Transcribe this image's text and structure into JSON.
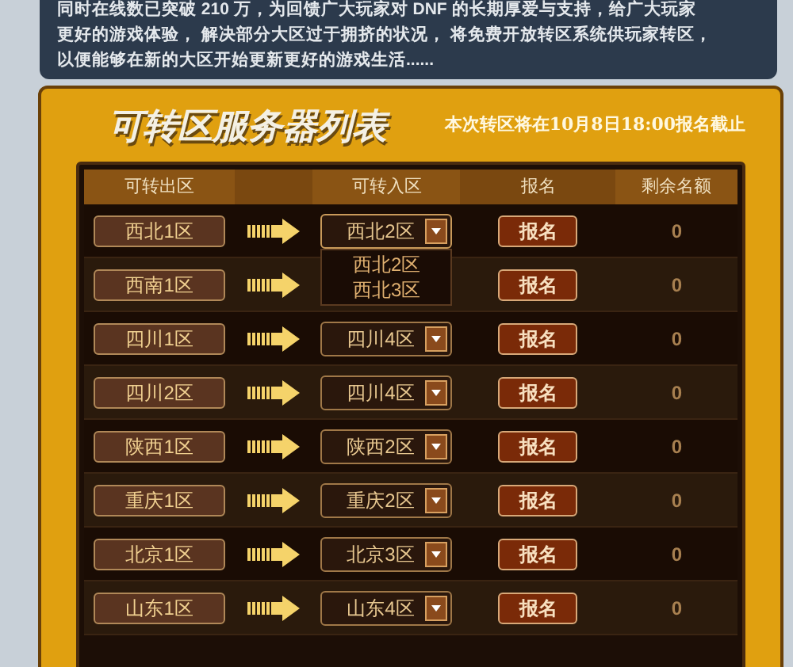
{
  "intro": {
    "lines": [
      "同时在线数已突破 210 万，为回馈广大玩家对 DNF 的长期厚爱与支持，给广大玩家",
      "更好的游戏体验， 解决部分大区过于拥挤的状况， 将免费开放转区系统供玩家转区，",
      "以便能够在新的大区开始更新更好的游戏生活......"
    ]
  },
  "panel": {
    "title": "可转区服务器列表",
    "notice": "本次转区将在10月8日18:00报名截止"
  },
  "table": {
    "columns": [
      "可转出区",
      "可转入区",
      "报名",
      "剩余名额"
    ],
    "rows": [
      {
        "source": "西北1区",
        "target": {
          "value": "西北2区",
          "expanded": true,
          "options": [
            "西北2区",
            "西北3区"
          ]
        },
        "action": "报名",
        "remaining": "0"
      },
      {
        "source": "西南1区",
        "action": "报名",
        "remaining": "0"
      },
      {
        "source": "四川1区",
        "target": {
          "value": "四川4区",
          "expanded": false
        },
        "action": "报名",
        "remaining": "0"
      },
      {
        "source": "四川2区",
        "target": {
          "value": "四川4区",
          "expanded": false
        },
        "action": "报名",
        "remaining": "0"
      },
      {
        "source": "陕西1区",
        "target": {
          "value": "陕西2区",
          "expanded": false
        },
        "action": "报名",
        "remaining": "0"
      },
      {
        "source": "重庆1区",
        "target": {
          "value": "重庆2区",
          "expanded": false
        },
        "action": "报名",
        "remaining": "0"
      },
      {
        "source": "北京1区",
        "target": {
          "value": "北京3区",
          "expanded": false
        },
        "action": "报名",
        "remaining": "0"
      },
      {
        "source": "山东1区",
        "target": {
          "value": "山东4区",
          "expanded": false
        },
        "action": "报名",
        "remaining": "0"
      }
    ]
  }
}
